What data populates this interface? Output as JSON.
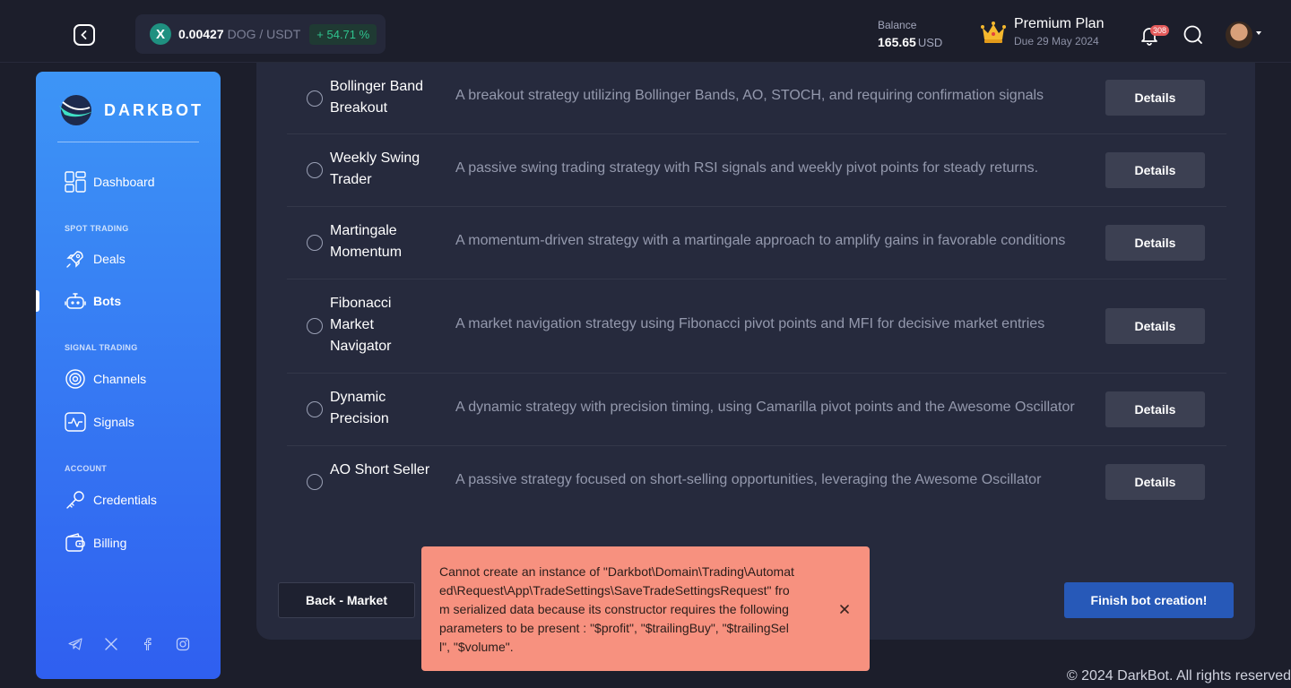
{
  "header": {
    "ticker": {
      "icon": "x-coin-icon",
      "price": "0.00427",
      "pair": "DOG / USDT",
      "change": "+ 54.71 %"
    },
    "balance": {
      "label": "Balance",
      "value": "165.65",
      "unit": "USD"
    },
    "plan": {
      "name": "Premium Plan",
      "due": "Due 29 May 2024"
    },
    "notifications_count": "308"
  },
  "sidebar": {
    "brand": "DARKBOT",
    "nav": {
      "dashboard": "Dashboard",
      "spot_section": "SPOT TRADING",
      "deals": "Deals",
      "bots": "Bots",
      "signal_section": "SIGNAL TRADING",
      "channels": "Channels",
      "signals": "Signals",
      "account_section": "ACCOUNT",
      "credentials": "Credentials",
      "billing": "Billing"
    },
    "active": "bots"
  },
  "strategies": [
    {
      "name": "Bollinger Band Breakout",
      "description": "A breakout strategy utilizing Bollinger Bands, AO, STOCH, and requiring confirmation signals",
      "action": "Details"
    },
    {
      "name": "Weekly Swing Trader",
      "description": "A passive swing trading strategy with RSI signals and weekly pivot points for steady returns.",
      "action": "Details"
    },
    {
      "name": "Martingale Momentum",
      "description": "A momentum-driven strategy with a martingale approach to amplify gains in favorable conditions",
      "action": "Details"
    },
    {
      "name": "Fibonacci Market Navigator",
      "description": "A market navigation strategy using Fibonacci pivot points and MFI for decisive market entries",
      "action": "Details"
    },
    {
      "name": "Dynamic Precision",
      "description": "A dynamic strategy with precision timing, using Camarilla pivot points and the Awesome Oscillator",
      "action": "Details"
    },
    {
      "name": "AO Short Seller",
      "description": "A passive strategy focused on short-selling opportunities, leveraging the Awesome Oscillator",
      "action": "Details"
    }
  ],
  "actions": {
    "back": "Back - Market",
    "finish": "Finish bot creation!"
  },
  "toast": {
    "message": "Cannot create an instance of \"Darkbot\\Domain\\Trading\\Automated\\Request\\App\\TradeSettings\\SaveTradeSettingsRequest\" from serialized data because its constructor requires the following parameters to be present : \"$profit\", \"$trailingBuy\", \"$trailingSell\", \"$volume\"."
  },
  "footer": "© 2024 DarkBot. All rights reserved"
}
